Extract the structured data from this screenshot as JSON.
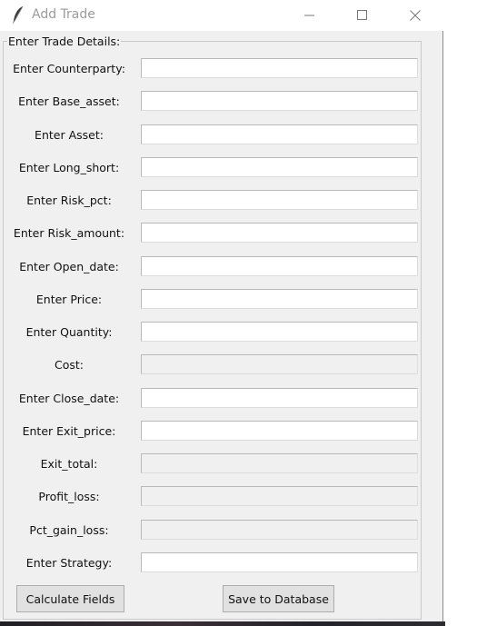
{
  "window": {
    "title": "Add Trade",
    "icon": "feather-icon"
  },
  "group": {
    "label": "Enter Trade Details:"
  },
  "fields": [
    {
      "label": "Enter Counterparty:",
      "value": "",
      "editable": true
    },
    {
      "label": "Enter Base_asset:",
      "value": "",
      "editable": true
    },
    {
      "label": "Enter Asset:",
      "value": "",
      "editable": true
    },
    {
      "label": "Enter Long_short:",
      "value": "",
      "editable": true
    },
    {
      "label": "Enter Risk_pct:",
      "value": "",
      "editable": true
    },
    {
      "label": "Enter Risk_amount:",
      "value": "",
      "editable": true
    },
    {
      "label": "Enter Open_date:",
      "value": "",
      "editable": true
    },
    {
      "label": "Enter Price:",
      "value": "",
      "editable": true
    },
    {
      "label": "Enter Quantity:",
      "value": "",
      "editable": true
    },
    {
      "label": "Cost:",
      "value": "",
      "editable": false
    },
    {
      "label": "Enter Close_date:",
      "value": "",
      "editable": true
    },
    {
      "label": "Enter Exit_price:",
      "value": "",
      "editable": true
    },
    {
      "label": "Exit_total:",
      "value": "",
      "editable": false
    },
    {
      "label": "Profit_loss:",
      "value": "",
      "editable": false
    },
    {
      "label": "Pct_gain_loss:",
      "value": "",
      "editable": false
    },
    {
      "label": "Enter Strategy:",
      "value": "",
      "editable": true
    }
  ],
  "buttons": {
    "calculate": "Calculate Fields",
    "save": "Save to Database"
  }
}
